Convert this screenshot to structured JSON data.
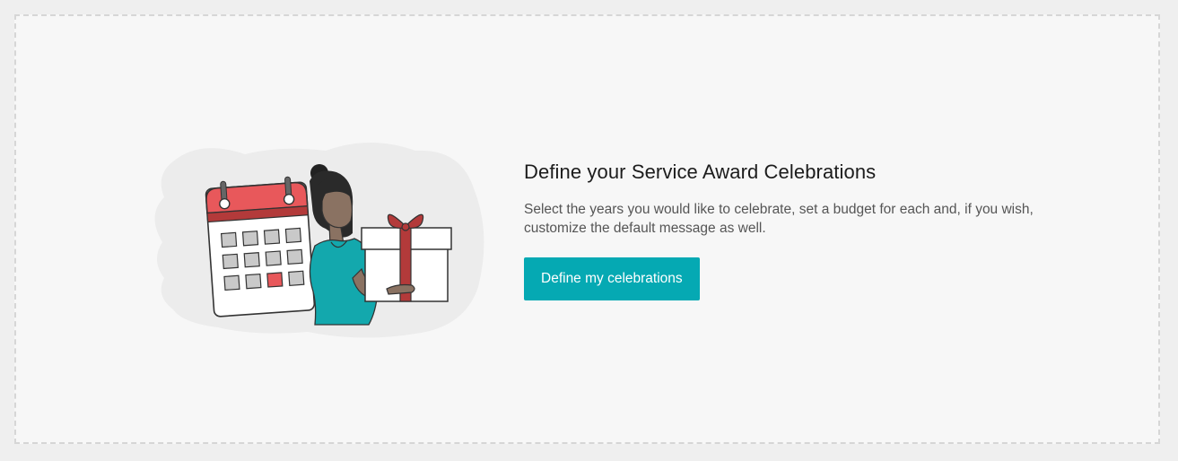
{
  "empty_state": {
    "title": "Define your Service Award Celebrations",
    "description": "Select the years you would like to celebrate, set a budget for each and, if you wish, customize the default message as well.",
    "button_label": "Define my celebrations",
    "illustration": "woman-holding-gift-calendar-illustration"
  },
  "colors": {
    "accent": "#05a9b3",
    "calendar_header": "#e8585b",
    "gift_ribbon": "#b33a3a",
    "shirt": "#13a8ad"
  }
}
